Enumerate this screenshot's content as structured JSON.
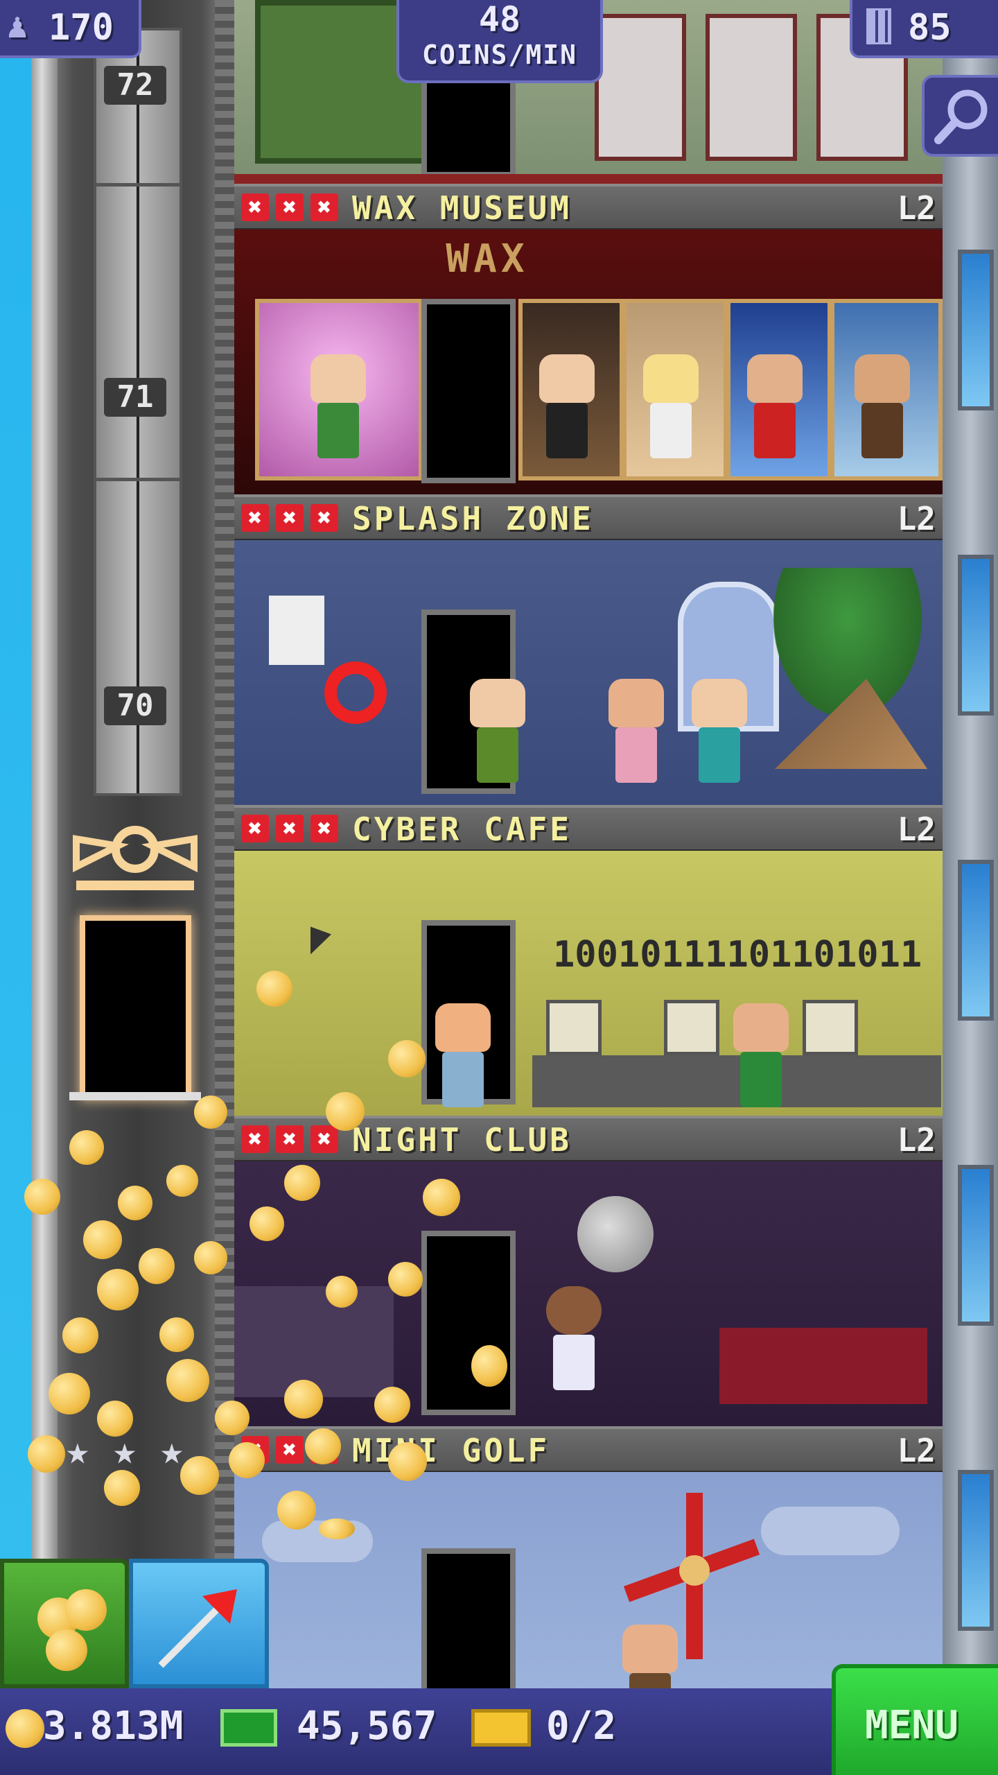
{
  "hud": {
    "population": "170",
    "coins_per_min_value": "48",
    "coins_per_min_label": "COINS/MIN",
    "floor_count": "85"
  },
  "elevator": {
    "floor_numbers": [
      "72",
      "71",
      "70"
    ]
  },
  "floors": [
    {
      "name": "WAX MUSEUM",
      "level": "L2",
      "sign": "WAX"
    },
    {
      "name": "SPLASH ZONE",
      "level": "L2"
    },
    {
      "name": "CYBER CAFE",
      "level": "L2",
      "binary_text": "10010111101101011"
    },
    {
      "name": "NIGHT CLUB",
      "level": "L2"
    },
    {
      "name": "MINI GOLF",
      "level": "L2"
    }
  ],
  "bottom": {
    "coins": "3.813M",
    "bux": "45,567",
    "tickets": "0/2",
    "menu_label": "MENU"
  },
  "colors": {
    "hud_pill": "#3c3d86",
    "menu_green": "#22c631",
    "coin_button_green": "#3b9a26",
    "raffle_blue": "#3aa8e6",
    "floor_title": "#f5f0a0"
  }
}
